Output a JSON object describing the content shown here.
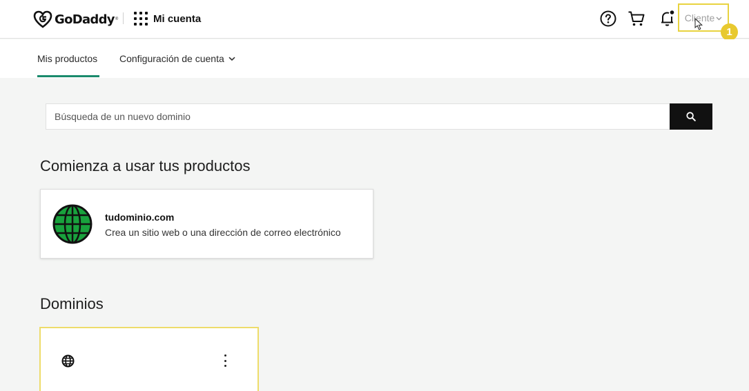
{
  "header": {
    "brand": "GoDaddy",
    "trademark": "®",
    "account_title": "Mi cuenta",
    "user_menu_label": "Cliente",
    "step_badge": "1"
  },
  "subnav": {
    "tabs": [
      {
        "label": "Mis productos",
        "active": true
      },
      {
        "label": "Configuración de cuenta",
        "active": false
      }
    ]
  },
  "search": {
    "placeholder": "Búsqueda de un nuevo dominio"
  },
  "products_section": {
    "title": "Comienza a usar tus productos",
    "card": {
      "domain": "tudominio.com",
      "description": "Crea un sitio web o una dirección de correo electrónico",
      "icon": "globe-icon"
    }
  },
  "domains_section": {
    "title": "Dominios",
    "card_icon": "globe-icon"
  },
  "colors": {
    "accent_tab": "#1a8a6c",
    "highlight": "#e8d33f",
    "globe_green": "#19a23d",
    "search_button": "#111111"
  }
}
